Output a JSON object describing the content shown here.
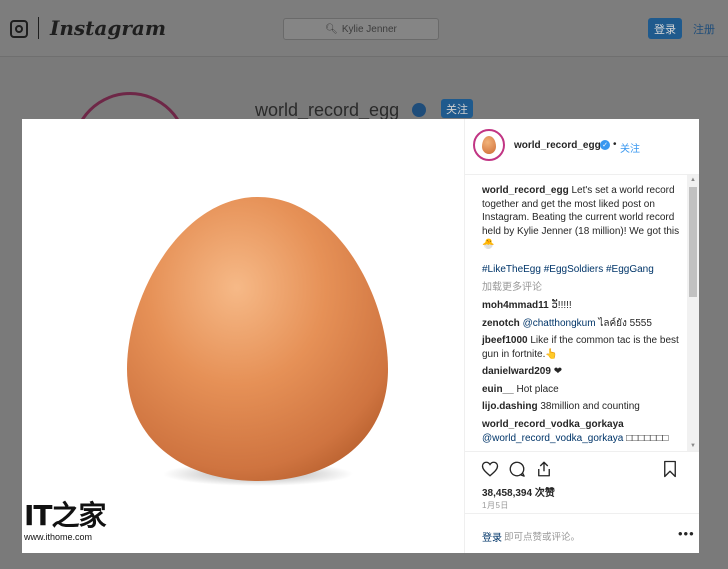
{
  "site": {
    "brand": "Instagram",
    "search_placeholder": "Kylie Jenner",
    "login_label": "登录",
    "register_label": "注册"
  },
  "profile": {
    "username": "world_record_egg",
    "follow_label": "关注"
  },
  "post": {
    "username": "world_record_egg",
    "follow_label": "关注",
    "caption_user": "world_record_egg",
    "caption_text": "Let's set a world record together and get the most liked post on Instagram. Beating the current world record held by Kylie Jenner (18 million)! We got this 🐣",
    "hashtags": "#LikeTheEgg #EggSoldiers #EggGang",
    "load_more": "加载更多评论",
    "comments": [
      {
        "user": "moh4mmad11",
        "text": "ວ່ັ!!!!!"
      },
      {
        "user": "zenotch",
        "mention": "@chatthongkum",
        "text": "ไลค์ยัง 5555"
      },
      {
        "user": "jbeef1000",
        "text": "Like if the common tac is the best gun in fortnite.👆"
      },
      {
        "user": "danielward209",
        "text": "❤"
      },
      {
        "user": "euin__",
        "text": "Hot place"
      },
      {
        "user": "lijo.dashing",
        "text": "38million and counting"
      },
      {
        "user": "world_record_vodka_gorkaya",
        "mention": "@world_record_vodka_gorkaya",
        "text": "□□□□□□□"
      }
    ],
    "likes": "38,458,394 次赞",
    "date": "1月5日",
    "add_comment_login": "登录",
    "add_comment_text": "即可点赞或评论。"
  },
  "watermark": {
    "big": "IT之家",
    "small": "www.ithome.com"
  },
  "icons": {
    "logo": "instagram-camera-icon",
    "search": "search-icon",
    "verified": "verified-badge-icon",
    "like": "heart-icon",
    "comment": "comment-icon",
    "share": "share-icon",
    "save": "bookmark-icon",
    "more": "more-options-icon"
  },
  "colors": {
    "link_blue": "#3897f0",
    "hashtag": "#003569",
    "egg": "#e08a52"
  }
}
